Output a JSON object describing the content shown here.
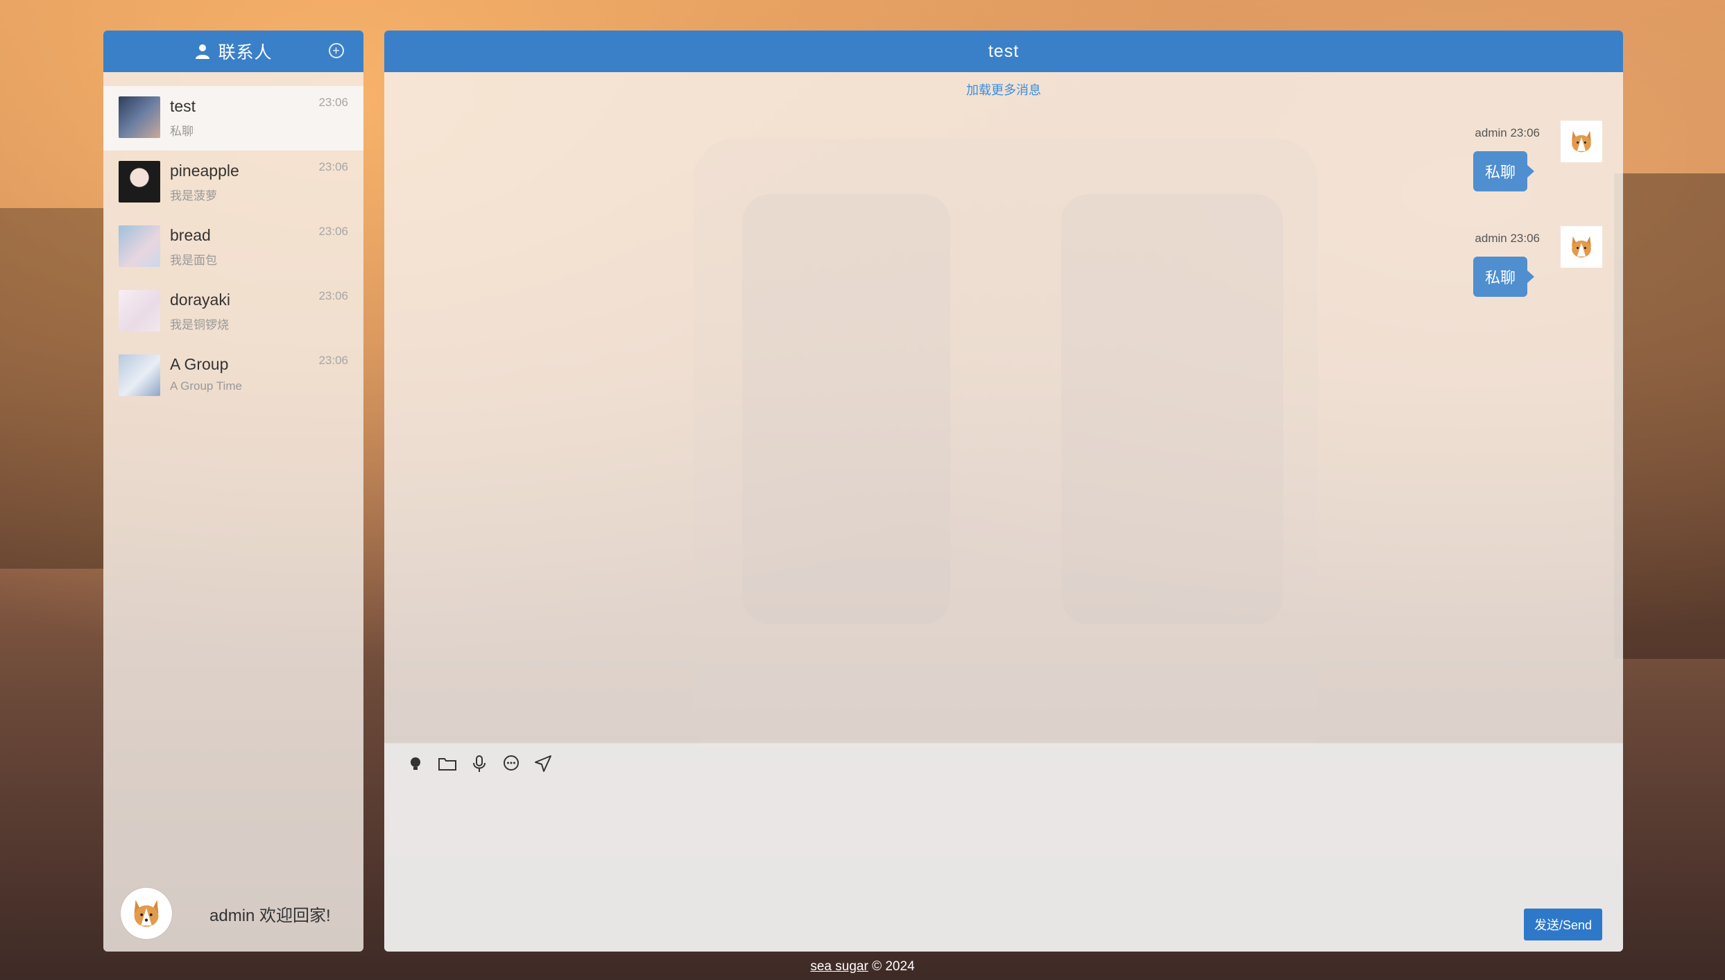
{
  "sidebar": {
    "title": "联系人",
    "contacts": [
      {
        "name": "test",
        "preview": "私聊",
        "time": "23:06"
      },
      {
        "name": "pineapple",
        "preview": "我是菠萝",
        "time": "23:06"
      },
      {
        "name": "bread",
        "preview": "我是面包",
        "time": "23:06"
      },
      {
        "name": "dorayaki",
        "preview": "我是铜锣烧",
        "time": "23:06"
      },
      {
        "name": "A Group",
        "preview": "A Group Time",
        "time": "23:06"
      }
    ],
    "footer_greeting": "admin 欢迎回家!"
  },
  "chat": {
    "title": "test",
    "load_more": "加载更多消息",
    "messages": [
      {
        "meta": "admin 23:06",
        "text": "私聊"
      },
      {
        "meta": "admin 23:06",
        "text": "私聊"
      }
    ],
    "send_label": "发送/Send"
  },
  "footer": {
    "brand": "sea sugar",
    "copyright": " © 2024"
  },
  "colors": {
    "header_blue": "#3a80c9",
    "bubble_blue": "#4f8fd0",
    "link_blue": "#3a8fde"
  },
  "icons": [
    "person-icon",
    "add-circle-icon",
    "bulb-icon",
    "folder-icon",
    "microphone-icon",
    "chat-bubble-icon",
    "send-arrow-icon",
    "corgi-avatar-icon"
  ]
}
